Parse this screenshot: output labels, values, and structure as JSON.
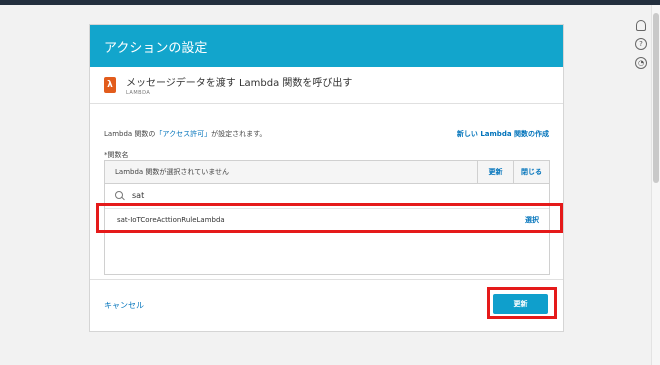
{
  "dialog": {
    "title": "アクションの設定",
    "action": {
      "title": "メッセージデータを渡す Lambda 関数を呼び出す",
      "subtitle": "LAMBDA"
    },
    "info": {
      "prefix": "Lambda 関数の",
      "link": "「アクセス許可」",
      "suffix": "が設定されます。",
      "new_link": "新しい Lambda 関数の作成"
    },
    "field_label": "*関数名",
    "table": {
      "header_text": "Lambda 関数が選択されていません",
      "refresh_label": "更新",
      "close_label": "閉じる",
      "search_value": "sat",
      "results": [
        {
          "name": "sat-IoTCoreActtionRuleLambda",
          "action": "選択"
        }
      ]
    },
    "footer": {
      "cancel_label": "キャンセル",
      "update_label": "更新"
    }
  },
  "side_icons": [
    "bell-icon",
    "help-icon",
    "settings-icon"
  ],
  "colors": {
    "header": "#12a5cc",
    "accent": "#0073bb",
    "highlight": "#e51a1a",
    "lambda": "#e25c1c"
  }
}
